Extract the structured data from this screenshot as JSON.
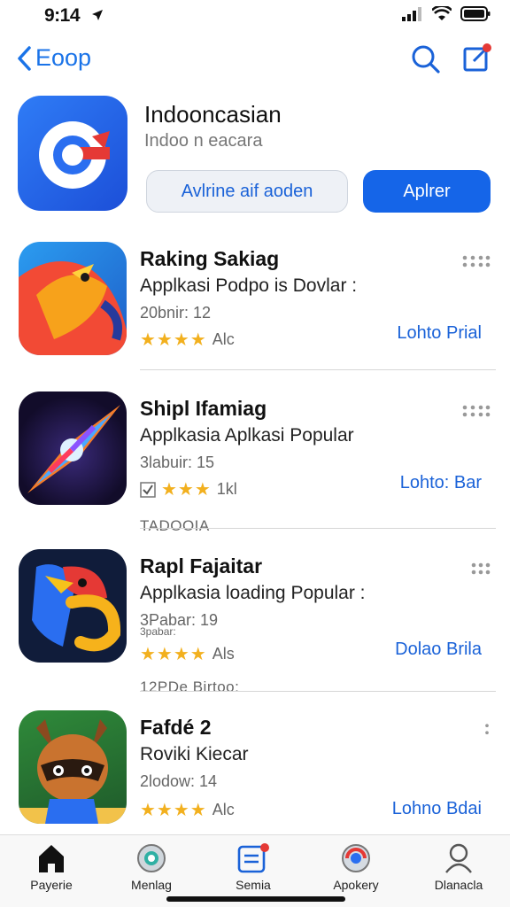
{
  "status": {
    "time": "9:14"
  },
  "nav": {
    "back_label": "Eoop"
  },
  "featured": {
    "title": "Indooncasian",
    "subtitle": "Indoo n eacara",
    "secondary_button": "Avlrine aif aoden",
    "primary_button": "Aplrer"
  },
  "apps": [
    {
      "name": "Raking Sakiag",
      "desc": "Applkasi Podpo is Dovlar :",
      "meta": "20bnir: 12",
      "stars": "★★★★",
      "rating_count": "Alc",
      "action": "Lohto Prial"
    },
    {
      "name": "Shipl Ifamiag",
      "desc": "Applkasia Aplkasi Popular",
      "meta": "3labuir: 15",
      "stars": "★★★",
      "rating_count": "1kl",
      "action": "Lohto: Bar"
    },
    {
      "name": "Rapl Fajaitar",
      "desc": "Applkasia loading Popular :",
      "meta": "3Pabar: 19",
      "meta2": "3pabar:",
      "stars": "★★★★",
      "rating_count": "Als",
      "action": "Dolao Brila"
    },
    {
      "name": "Fafdé 2",
      "desc": "Roviki Kiecar",
      "meta": "2lodow: 14",
      "stars": "★★★★",
      "rating_count": "Alc",
      "action": "Lohno Bdai"
    }
  ],
  "sections": {
    "label1": "TADOOIA",
    "label2": "12PDe Birtoo:"
  },
  "tabs": [
    {
      "label": "Payerie"
    },
    {
      "label": "Menlag"
    },
    {
      "label": "Semia"
    },
    {
      "label": "Apokery"
    },
    {
      "label": "Dlanacla"
    }
  ],
  "colors": {
    "accent": "#1565e8",
    "star": "#f2b01e",
    "badge": "#e53935"
  }
}
